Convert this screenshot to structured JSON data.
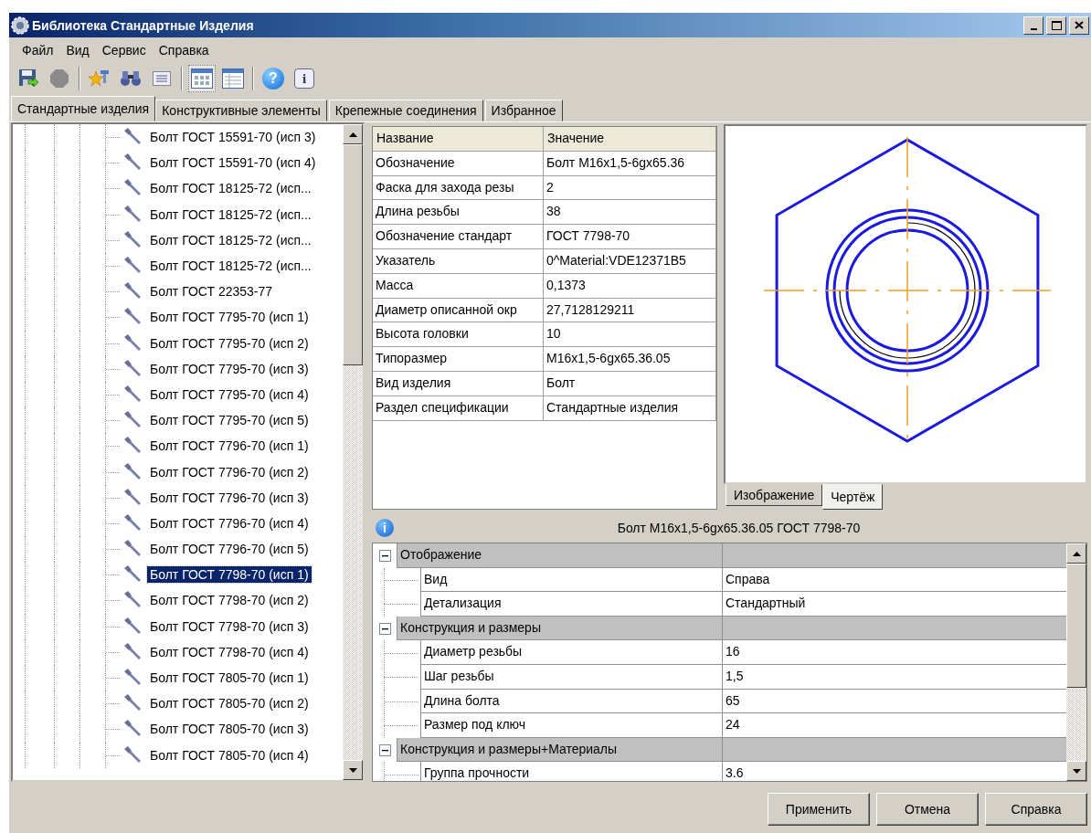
{
  "window": {
    "title": "Библиотека Стандартные Изделия"
  },
  "menu": [
    "Файл",
    "Вид",
    "Сервис",
    "Справка"
  ],
  "toolbar": [
    {
      "kind": "save"
    },
    {
      "kind": "stop"
    },
    {
      "kind": "separator"
    },
    {
      "kind": "favorite"
    },
    {
      "kind": "search"
    },
    {
      "kind": "details"
    },
    {
      "kind": "separator"
    },
    {
      "kind": "view_icons",
      "selected": true
    },
    {
      "kind": "view_table",
      "selected": false
    },
    {
      "kind": "separator"
    },
    {
      "kind": "help",
      "glyph": "?"
    },
    {
      "kind": "info",
      "glyph": "i"
    }
  ],
  "tabs": [
    {
      "label": "Стандартные изделия",
      "selected": true
    },
    {
      "label": "Конструктивные элементы",
      "selected": false
    },
    {
      "label": "Крепежные соединения",
      "selected": false
    },
    {
      "label": "Избранное",
      "selected": false
    }
  ],
  "tree": {
    "items": [
      {
        "label": "Болт ГОСТ 15591-70 (исп 3)",
        "selected": false
      },
      {
        "label": "Болт ГОСТ 15591-70 (исп 4)",
        "selected": false
      },
      {
        "label": "Болт ГОСТ 18125-72 (исп...",
        "selected": false
      },
      {
        "label": "Болт ГОСТ 18125-72 (исп...",
        "selected": false
      },
      {
        "label": "Болт ГОСТ 18125-72 (исп...",
        "selected": false
      },
      {
        "label": "Болт ГОСТ 18125-72 (исп...",
        "selected": false
      },
      {
        "label": "Болт ГОСТ 22353-77",
        "selected": false
      },
      {
        "label": "Болт ГОСТ 7795-70 (исп 1)",
        "selected": false
      },
      {
        "label": "Болт ГОСТ 7795-70 (исп 2)",
        "selected": false
      },
      {
        "label": "Болт ГОСТ 7795-70 (исп 3)",
        "selected": false
      },
      {
        "label": "Болт ГОСТ 7795-70 (исп 4)",
        "selected": false
      },
      {
        "label": "Болт ГОСТ 7795-70 (исп 5)",
        "selected": false
      },
      {
        "label": "Болт ГОСТ 7796-70 (исп 1)",
        "selected": false
      },
      {
        "label": "Болт ГОСТ 7796-70 (исп 2)",
        "selected": false
      },
      {
        "label": "Болт ГОСТ 7796-70 (исп 3)",
        "selected": false
      },
      {
        "label": "Болт ГОСТ 7796-70 (исп 4)",
        "selected": false
      },
      {
        "label": "Болт ГОСТ 7796-70 (исп 5)",
        "selected": false
      },
      {
        "label": "Болт ГОСТ 7798-70 (исп 1)",
        "selected": true
      },
      {
        "label": "Болт ГОСТ 7798-70 (исп 2)",
        "selected": false
      },
      {
        "label": "Болт ГОСТ 7798-70 (исп 3)",
        "selected": false
      },
      {
        "label": "Болт ГОСТ 7798-70 (исп 4)",
        "selected": false
      },
      {
        "label": "Болт ГОСТ 7805-70 (исп 1)",
        "selected": false
      },
      {
        "label": "Болт ГОСТ 7805-70 (исп 2)",
        "selected": false
      },
      {
        "label": "Болт ГОСТ 7805-70 (исп 3)",
        "selected": false
      },
      {
        "label": "Болт ГОСТ 7805-70 (исп 4)",
        "selected": false
      }
    ]
  },
  "properties_table": {
    "columns": [
      "Название",
      "Значение"
    ],
    "rows": [
      {
        "name": "Обозначение",
        "value": "Болт М16x1,5-6gx65.36"
      },
      {
        "name": "Фаска для захода резы",
        "value": "2"
      },
      {
        "name": "Длина резьбы",
        "value": "38"
      },
      {
        "name": "Обозначение стандарт",
        "value": "ГОСТ 7798-70"
      },
      {
        "name": "Указатель",
        "value": "0^Material:VDE12371B5"
      },
      {
        "name": "Масса",
        "value": "0,1373"
      },
      {
        "name": "Диаметр описанной окр",
        "value": "27,7128129211"
      },
      {
        "name": "Высота головки",
        "value": "10"
      },
      {
        "name": "Типоразмер",
        "value": "М16x1,5-6gx65.36.05"
      },
      {
        "name": "Вид изделия",
        "value": "Болт"
      },
      {
        "name": "Раздел спецификации",
        "value": "Стандартные изделия"
      }
    ]
  },
  "preview": {
    "tabs": [
      {
        "label": "Изображение",
        "selected": false
      },
      {
        "label": "Чертёж",
        "selected": true
      }
    ]
  },
  "info": {
    "glyph": "i",
    "title": "Болт М16x1,5-6gx65.36.05 ГОСТ 7798-70"
  },
  "property_grid": {
    "groups": [
      {
        "label": "Отображение",
        "expanded": true,
        "rows": [
          {
            "name": "Вид",
            "value": "Справа"
          },
          {
            "name": "Детализация",
            "value": "Стандартный"
          }
        ]
      },
      {
        "label": "Конструкция и размеры",
        "expanded": true,
        "rows": [
          {
            "name": "Диаметр резьбы",
            "value": "16"
          },
          {
            "name": "Шаг резьбы",
            "value": "1,5"
          },
          {
            "name": "Длина болта",
            "value": "65"
          },
          {
            "name": "Размер под ключ",
            "value": "24"
          }
        ]
      },
      {
        "label": "Конструкция и размеры+Материалы",
        "expanded": true,
        "rows": [
          {
            "name": "Группа прочности",
            "value": "3.6"
          }
        ]
      }
    ]
  },
  "buttons": [
    "Применить",
    "Отмена",
    "Справка"
  ]
}
